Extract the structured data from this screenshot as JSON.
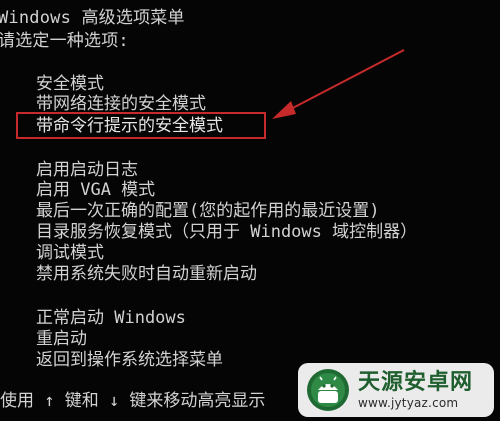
{
  "header": {
    "title": "Windows 高级选项菜单",
    "prompt": "请选定一种选项:"
  },
  "menu": {
    "group1": [
      {
        "label": "安全模式"
      },
      {
        "label": "带网络连接的安全模式"
      },
      {
        "label": "带命令行提示的安全模式",
        "highlighted": true
      }
    ],
    "group2": [
      {
        "label": "启用启动日志"
      },
      {
        "label": "启用 VGA 模式"
      },
      {
        "label": "最后一次正确的配置(您的起作用的最近设置)"
      },
      {
        "label": "目录服务恢复模式（只用于 Windows 域控制器）"
      },
      {
        "label": "调试模式"
      },
      {
        "label": "禁用系统失败时自动重新启动"
      }
    ],
    "group3": [
      {
        "label": "正常启动 Windows"
      },
      {
        "label": "重启动"
      },
      {
        "label": "返回到操作系统选择菜单"
      }
    ]
  },
  "footer": {
    "hint": "使用 ↑ 键和 ↓ 键来移动高亮显示"
  },
  "watermark": {
    "title": "天源安卓网",
    "url": "www.jytyaz.com",
    "icon": "android-robot-logo-icon"
  },
  "colors": {
    "background": "#050505",
    "text": "#d2d2d2",
    "highlight_box": "#c62a2a",
    "arrow": "#c62a2a",
    "watermark_green": "#1f5f2f"
  }
}
